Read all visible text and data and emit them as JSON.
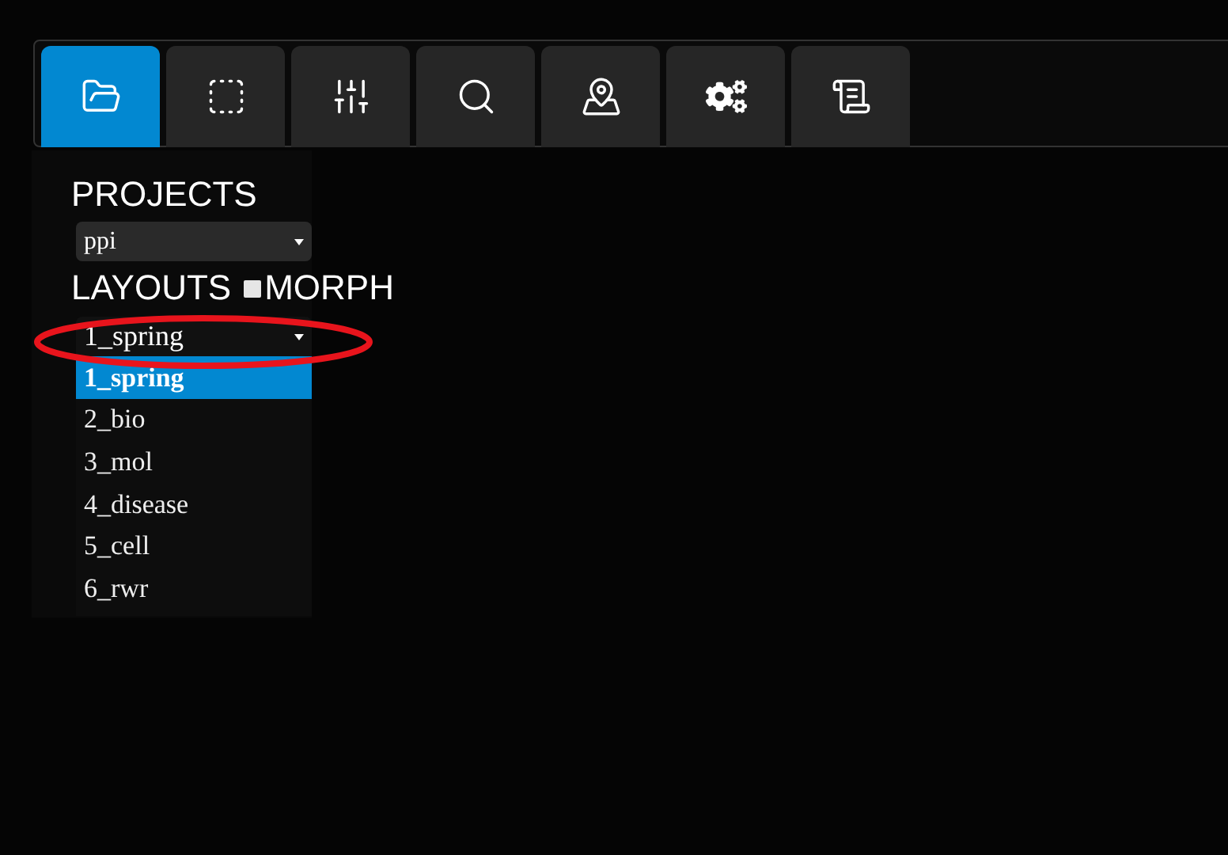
{
  "toolbar": [
    {
      "kind": "folder",
      "selected": true
    },
    {
      "kind": "select",
      "selected": false
    },
    {
      "kind": "sliders",
      "selected": false
    },
    {
      "kind": "search",
      "selected": false
    },
    {
      "kind": "pin",
      "selected": false
    },
    {
      "kind": "gears",
      "selected": false
    },
    {
      "kind": "scroll",
      "selected": false
    }
  ],
  "projects": {
    "label": "PROJECTS",
    "value": "ppi"
  },
  "layouts": {
    "label": "LAYOUTS",
    "morph": {
      "label": "MORPH",
      "checked": false
    },
    "value": "1_spring",
    "expanded": true,
    "options": [
      {
        "label": "1_spring",
        "selected": true
      },
      {
        "label": "2_bio",
        "selected": false
      },
      {
        "label": "3_mol",
        "selected": false
      },
      {
        "label": "4_disease",
        "selected": false
      },
      {
        "label": "5_cell",
        "selected": false
      },
      {
        "label": "6_rwr",
        "selected": false
      }
    ]
  }
}
